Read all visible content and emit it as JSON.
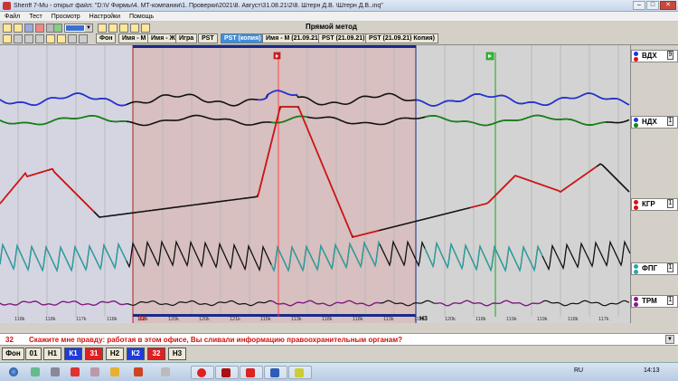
{
  "window": {
    "title": "Sheriff 7-Mu - открыт файл: \"D:\\V Фирмы\\4. МТ-компании\\1. Проверки\\2021\\8. Август\\31.08.21\\2\\8. Штерн Д.В. \\Штерн Д.В..inq\"",
    "buttons": [
      "–",
      "□",
      "✕"
    ]
  },
  "menu": [
    "Файл",
    "Тест",
    "Просмотр",
    "Настройки",
    "Помощь"
  ],
  "toolbar": {
    "method_title": "Прямой метод",
    "tabs": [
      "Фон",
      "Имя - М",
      "Имя - Ж",
      "Игра",
      "PST",
      "PST (копия)",
      "Имя - М (21.09.21)",
      "PST (21.09.21)",
      "PST (21.09.21) Копия)"
    ],
    "active_tab_index": 5
  },
  "channels": [
    {
      "name": "ВДХ",
      "num": "9",
      "color": "#2233dd"
    },
    {
      "name": "НДХ",
      "num": "1",
      "color": "#118811"
    },
    {
      "name": "КГР",
      "num": "1",
      "color": "#dd1111"
    },
    {
      "name": "ФПГ",
      "num": "1",
      "color": "#2aa6a6"
    },
    {
      "name": "ТРМ",
      "num": "1",
      "color": "#8a1a8a"
    }
  ],
  "markers": {
    "question_start": "32",
    "question_end": "Н3"
  },
  "time_labels": [
    "118k",
    "118k",
    "117k",
    "118k",
    "119k",
    "120k",
    "120k",
    "121k",
    "115k",
    "113k",
    "118k",
    "118k",
    "113k",
    "119k",
    "120k",
    "118k",
    "119k",
    "119k",
    "118k",
    "117k"
  ],
  "question": {
    "number": "32",
    "text": "Скажите мне правду: работая в этом офисе, Вы сливали информацию правоохранительным  органам?"
  },
  "question_buttons": [
    {
      "label": "Фон",
      "style": "plain"
    },
    {
      "label": "01",
      "style": "plain"
    },
    {
      "label": "Н1",
      "style": "plain"
    },
    {
      "label": "К1",
      "style": "blue"
    },
    {
      "label": "31",
      "style": "red"
    },
    {
      "label": "Н2",
      "style": "plain"
    },
    {
      "label": "К2",
      "style": "blue"
    },
    {
      "label": "32",
      "style": "red"
    },
    {
      "label": "Н3",
      "style": "plain"
    }
  ],
  "taskbar": {
    "lang": "RU",
    "time": "14:13"
  },
  "colors": {
    "chart_bg": "#dcdcdc",
    "question_region": "#d8bfc0",
    "region_border": "#1a2a8a",
    "question_text": "#d01010"
  }
}
